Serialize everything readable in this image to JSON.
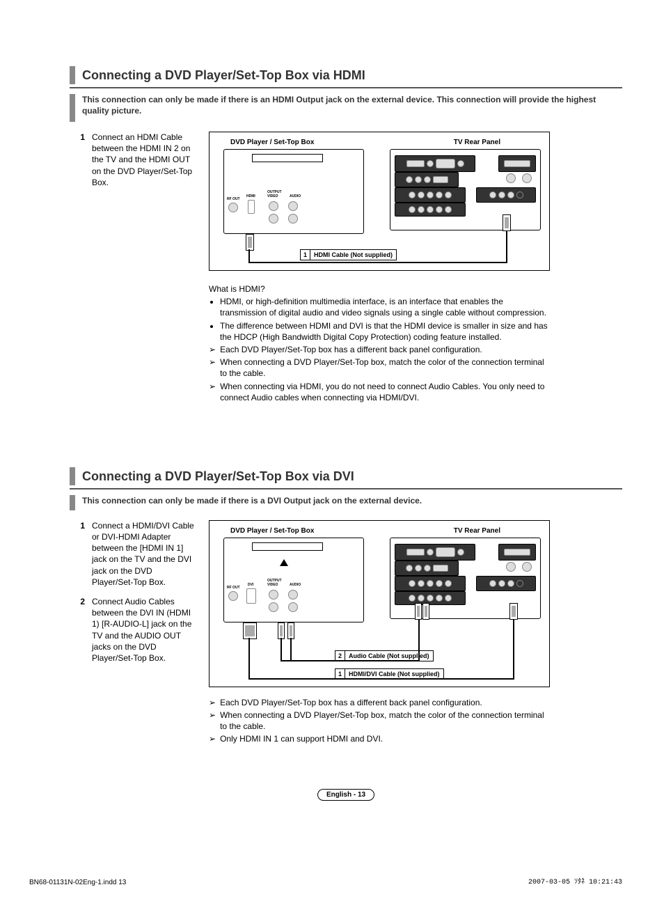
{
  "section1": {
    "title": "Connecting a DVD Player/Set-Top Box via HDMI",
    "note": "This connection can only be made if there is an HDMI Output jack on the external device. This connection will provide the highest quality picture.",
    "step1_num": "1",
    "step1_text": "Connect an HDMI Cable between the HDMI IN 2 on the TV and the HDMI OUT on the DVD Player/Set-Top Box.",
    "diagram": {
      "left_label": "DVD Player / Set-Top Box",
      "right_label": "TV Rear Panel",
      "cable1_num": "1",
      "cable1_text": "HDMI Cable (Not supplied)",
      "player_out_label": "OUTPUT",
      "player_ports": {
        "rf": "RF OUT",
        "hdmi": "HDMI",
        "video": "VIDEO",
        "audio": "AUDIO"
      }
    },
    "explain": {
      "q": "What is HDMI?",
      "b1": "HDMI, or high-definition multimedia interface, is an interface that enables the transmission of digital audio and video signals using a single cable without compression.",
      "b2": "The difference between HDMI and DVI is that the HDMI device is smaller in size and has the HDCP (High Bandwidth Digital Copy Protection) coding feature installed.",
      "a1": "Each DVD Player/Set-Top box has a different back panel configuration.",
      "a2": "When connecting a DVD Player/Set-Top box, match the color of the connection terminal to the cable.",
      "a3": "When connecting via HDMI, you do not need to connect Audio Cables. You only need to connect Audio cables when connecting via HDMI/DVI."
    }
  },
  "section2": {
    "title": "Connecting a DVD Player/Set-Top Box via DVI",
    "note": "This connection can only be made if there is a DVI Output jack on the external device.",
    "step1_num": "1",
    "step1_text": "Connect a HDMI/DVI Cable or DVI-HDMI Adapter between the [HDMI IN 1] jack on the TV and the DVI jack on the DVD Player/Set-Top Box.",
    "step2_num": "2",
    "step2_text": "Connect Audio Cables between the DVI IN (HDMI 1) [R-AUDIO-L] jack on the TV and the AUDIO OUT jacks on the DVD Player/Set-Top Box.",
    "diagram": {
      "left_label": "DVD Player / Set-Top Box",
      "right_label": "TV Rear Panel",
      "cable1_num": "1",
      "cable1_text": "HDMI/DVI Cable (Not supplied)",
      "cable2_num": "2",
      "cable2_text": "Audio Cable (Not supplied)",
      "player_out_label": "OUTPUT",
      "player_ports": {
        "rf": "RF OUT",
        "dvi": "DVI",
        "video": "VIDEO",
        "audio": "AUDIO"
      }
    },
    "explain": {
      "a1": "Each DVD Player/Set-Top box has a different back panel configuration.",
      "a2": "When connecting a DVD Player/Set-Top box, match the color of the connection terminal to the cable.",
      "a3": "Only HDMI IN 1 can support HDMI and DVI."
    }
  },
  "footer": {
    "page": "English - 13",
    "indd": "BN68-01131N-02Eng-1.indd   13",
    "timestamp": "2007-03-05   ｿﾀﾈ 10:21:43"
  }
}
